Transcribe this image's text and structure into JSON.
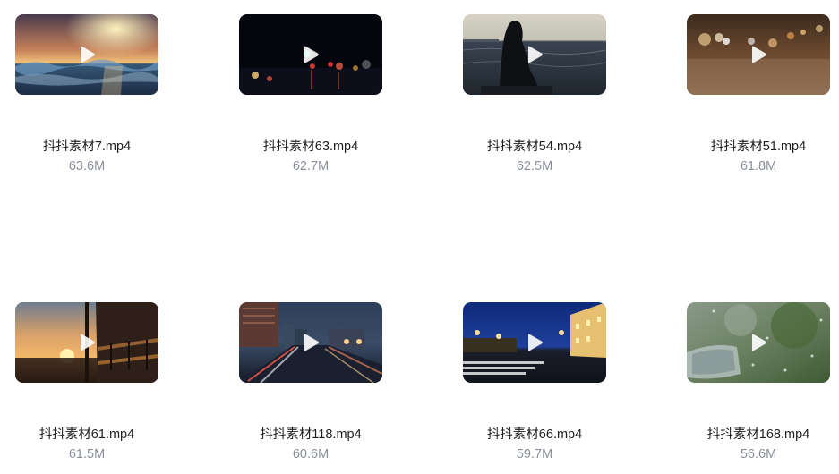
{
  "files": [
    {
      "name": "抖抖素材7.mp4",
      "size": "63.6M",
      "thumbnail": "sunset-over-sea"
    },
    {
      "name": "抖抖素材63.mp4",
      "size": "62.7M",
      "thumbnail": "night-traffic-bokeh"
    },
    {
      "name": "抖抖素材54.mp4",
      "size": "62.5M",
      "thumbnail": "woman-silhouette-by-sea"
    },
    {
      "name": "抖抖素材51.mp4",
      "size": "61.8M",
      "thumbnail": "blurred-city-road"
    },
    {
      "name": "抖抖素材61.mp4",
      "size": "61.5M",
      "thumbnail": "sunset-with-railing"
    },
    {
      "name": "抖抖素材118.mp4",
      "size": "60.6M",
      "thumbnail": "city-highway-night"
    },
    {
      "name": "抖抖素材66.mp4",
      "size": "59.7M",
      "thumbnail": "night-street-crosswalk"
    },
    {
      "name": "抖抖素材168.mp4",
      "size": "56.6M",
      "thumbnail": "rainy-window-mirror"
    }
  ]
}
